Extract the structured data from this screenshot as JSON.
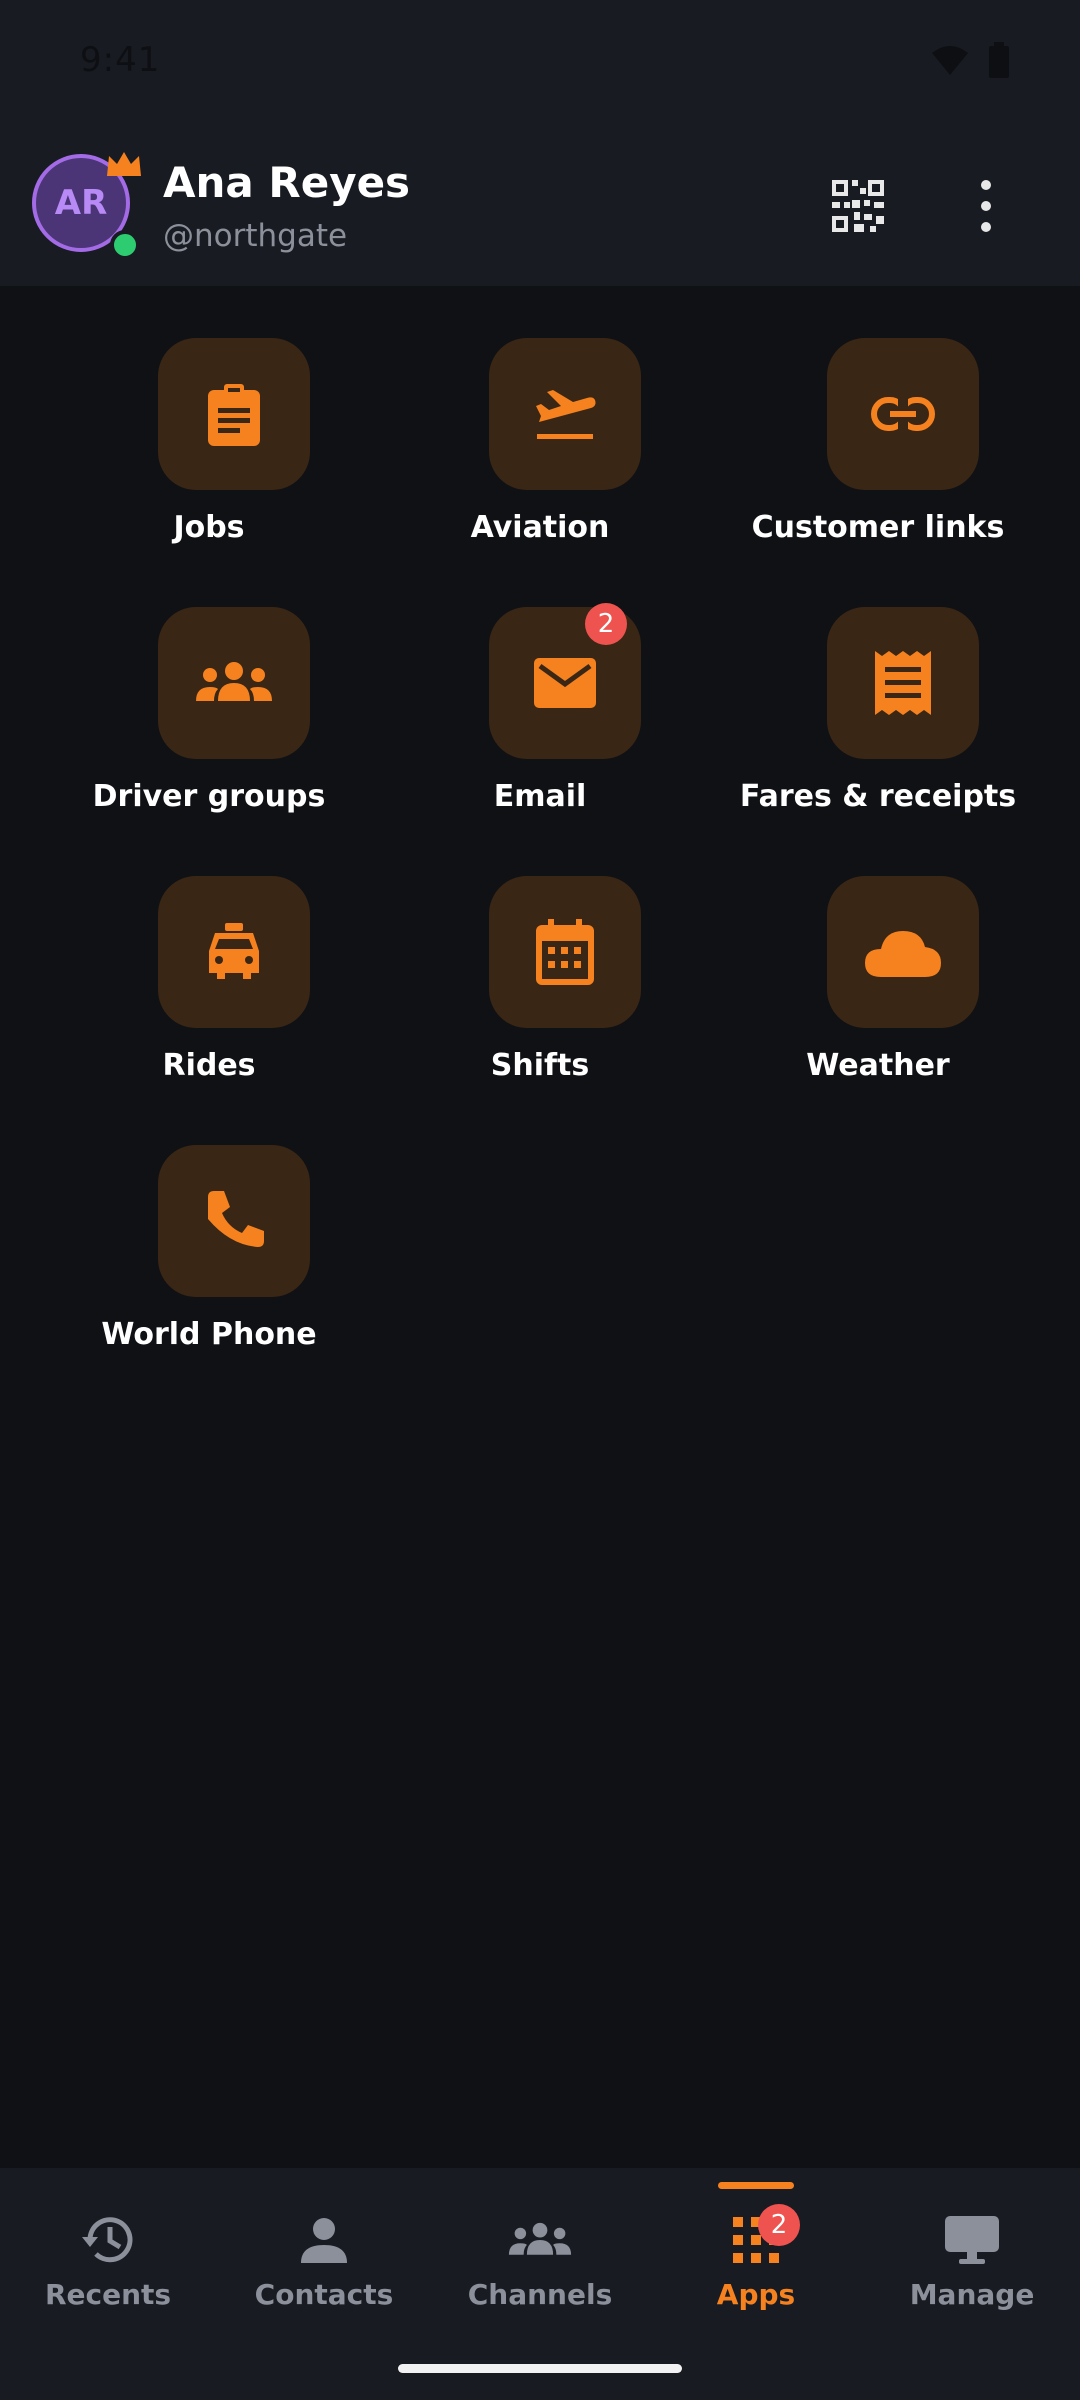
{
  "status_bar": {
    "time": "9:41"
  },
  "profile": {
    "initials": "AR",
    "name": "Ana Reyes",
    "handle": "@northgate"
  },
  "apps": [
    {
      "label": "Jobs",
      "icon": "clipboard-icon"
    },
    {
      "label": "Aviation",
      "icon": "plane-takeoff-icon"
    },
    {
      "label": "Customer links",
      "icon": "link-icon"
    },
    {
      "label": "Driver groups",
      "icon": "groups-icon"
    },
    {
      "label": "Email",
      "icon": "mail-icon",
      "badge": "2"
    },
    {
      "label": "Fares & receipts",
      "icon": "receipt-icon"
    },
    {
      "label": "Rides",
      "icon": "taxi-icon"
    },
    {
      "label": "Shifts",
      "icon": "calendar-icon"
    },
    {
      "label": "Weather",
      "icon": "cloud-icon"
    },
    {
      "label": "World Phone",
      "icon": "phone-icon"
    }
  ],
  "nav": {
    "items": [
      {
        "label": "Recents",
        "icon": "history-icon"
      },
      {
        "label": "Contacts",
        "icon": "person-icon"
      },
      {
        "label": "Channels",
        "icon": "groups-icon"
      },
      {
        "label": "Apps",
        "icon": "apps-grid-icon",
        "badge": "2",
        "active": true
      },
      {
        "label": "Manage",
        "icon": "monitor-icon"
      }
    ]
  },
  "colors": {
    "accent": "#f5821f",
    "tile_bg": "#3a2615",
    "badge": "#ef5350",
    "avatar_ring": "#a46be6"
  }
}
